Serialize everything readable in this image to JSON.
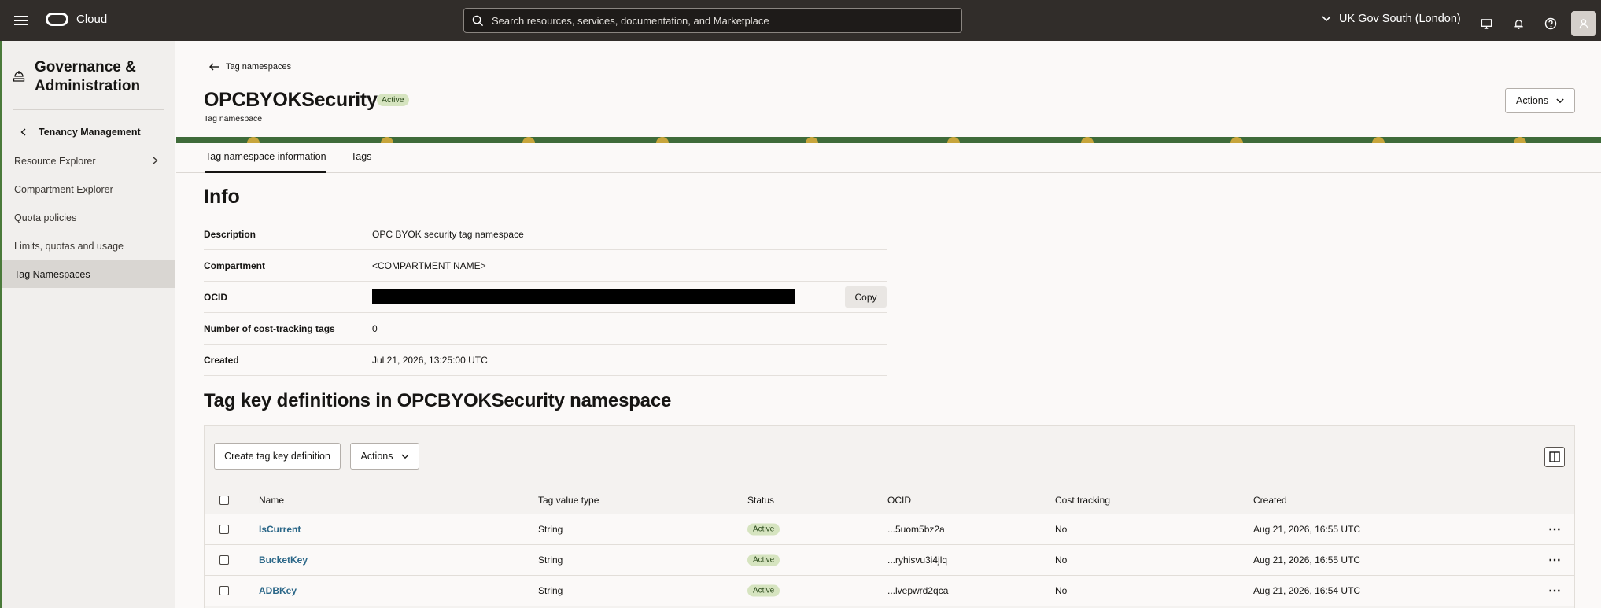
{
  "topbar": {
    "brand": "Cloud",
    "search_placeholder": "Search resources, services, documentation, and Marketplace",
    "region": "UK Gov South (London)"
  },
  "sidebar": {
    "title": "Governance & Administration",
    "back_label": "Tenancy Management",
    "items": [
      {
        "label": "Resource Explorer"
      },
      {
        "label": "Compartment Explorer"
      },
      {
        "label": "Quota policies"
      },
      {
        "label": "Limits, quotas and usage"
      },
      {
        "label": "Tag Namespaces"
      }
    ]
  },
  "header": {
    "breadcrumb": "Tag namespaces",
    "title": "OPCBYOKSecurity",
    "status": "Active",
    "subtitle": "Tag namespace",
    "actions_label": "Actions"
  },
  "tabs": [
    {
      "label": "Tag namespace information"
    },
    {
      "label": "Tags"
    }
  ],
  "info": {
    "title": "Info",
    "rows": [
      {
        "label": "Description",
        "value": "OPC BYOK security tag namespace"
      },
      {
        "label": "Compartment",
        "value": "<COMPARTMENT NAME>"
      },
      {
        "label": "OCID",
        "value": ""
      },
      {
        "label": "Number of cost-tracking tags",
        "value": "0"
      },
      {
        "label": "Created",
        "value": "Jul 21, 2026, 13:25:00 UTC"
      }
    ],
    "copy_label": "Copy"
  },
  "tag_keys": {
    "title": "Tag key definitions in OPCBYOKSecurity namespace",
    "create_label": "Create tag key definition",
    "actions_label": "Actions",
    "columns": [
      "Name",
      "Tag value type",
      "Status",
      "OCID",
      "Cost tracking",
      "Created"
    ],
    "rows": [
      {
        "name": "IsCurrent",
        "type": "String",
        "status": "Active",
        "ocid": "...5uom5bz2a",
        "cost": "No",
        "created": "Aug 21, 2026, 16:55 UTC"
      },
      {
        "name": "BucketKey",
        "type": "String",
        "status": "Active",
        "ocid": "...ryhisvu3i4jlq",
        "cost": "No",
        "created": "Aug 21, 2026, 16:55 UTC"
      },
      {
        "name": "ADBKey",
        "type": "String",
        "status": "Active",
        "ocid": "...lvepwrd2qca",
        "cost": "No",
        "created": "Aug 21, 2026, 16:54 UTC"
      }
    ]
  }
}
